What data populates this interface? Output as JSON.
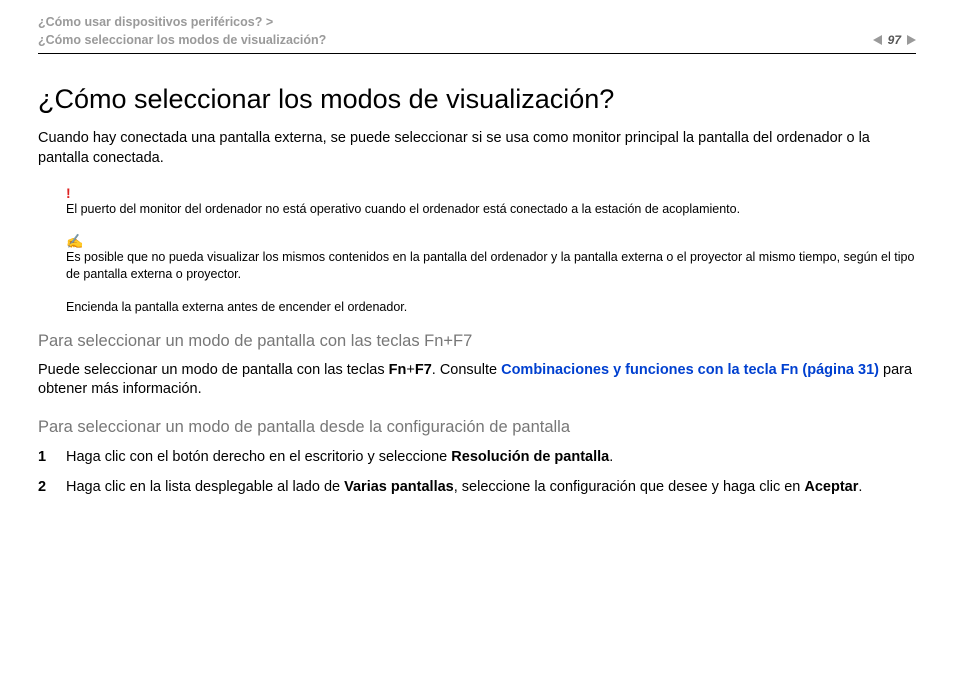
{
  "breadcrumb": {
    "line1": "¿Cómo usar dispositivos periféricos? >",
    "line2": "¿Cómo seleccionar los modos de visualización?"
  },
  "pager": {
    "page": "97"
  },
  "title": "¿Cómo seleccionar los modos de visualización?",
  "intro": "Cuando hay conectada una pantalla externa, se puede seleccionar si se usa como monitor principal la pantalla del ordenador o la pantalla conectada.",
  "warning_icon": "!",
  "warning_text": "El puerto del monitor del ordenador no está operativo cuando el ordenador está conectado a la estación de acoplamiento.",
  "info_icon": "✍",
  "info_text1": "Es posible que no pueda visualizar los mismos contenidos en la pantalla del ordenador y la pantalla externa o el proyector al mismo tiempo, según el tipo de pantalla externa o proyector.",
  "info_text2": "Encienda la pantalla externa antes de encender el ordenador.",
  "h2a": "Para seleccionar un modo de pantalla con las teclas Fn+F7",
  "p2": {
    "pre": "Puede seleccionar un modo de pantalla con las teclas ",
    "fn": "Fn",
    "plus": "+",
    "f7": "F7",
    "mid": ". Consulte ",
    "link": "Combinaciones y funciones con la tecla Fn (página 31)",
    "post": " para obtener más información."
  },
  "h2b": "Para seleccionar un modo de pantalla desde la configuración de pantalla",
  "steps": {
    "s1": {
      "pre": "Haga clic con el botón derecho en el escritorio y seleccione ",
      "b": "Resolución de pantalla",
      "post": "."
    },
    "s2": {
      "pre": "Haga clic en la lista desplegable al lado de ",
      "b1": "Varias pantallas",
      "mid": ", seleccione la configuración que desee y haga clic en ",
      "b2": "Aceptar",
      "post": "."
    }
  }
}
